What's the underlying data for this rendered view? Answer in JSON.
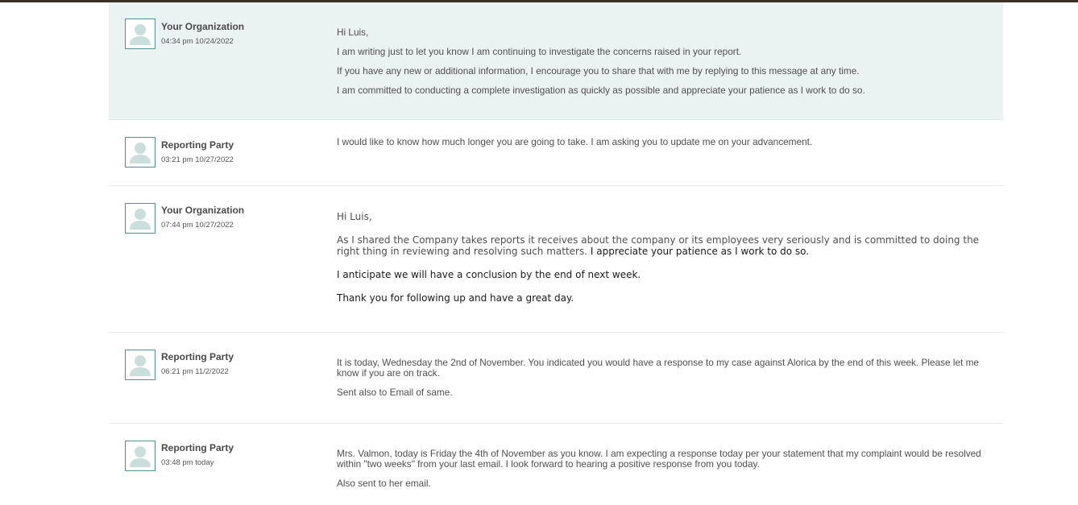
{
  "messages": [
    {
      "sender": "Your Organization",
      "time": "04:34 pm 10/24/2022",
      "paragraphs": [
        "Hi Luis,",
        "I am writing just to let you know I am continuing to investigate the concerns raised in your report.",
        "If you have any new or additional information, I encourage you to share that with me by replying to this message at any time.",
        "I am committed to conducting a complete investigation as quickly as possible and appreciate your patience as I work to do so."
      ]
    },
    {
      "sender": "Reporting Party",
      "time": "03:21 pm 10/27/2022",
      "paragraphs": [
        "I would like to know how much longer you are going to take. I am asking you to update me on your advancement."
      ]
    },
    {
      "sender": "Your Organization",
      "time": "07:44 pm 10/27/2022",
      "greeting": "Hi Luis,",
      "para1_gray": "As I shared the Company takes reports it receives about the company or its employees very seriously and is committed to doing the right thing in reviewing and resolving such matters.",
      "para1_dark": " I appreciate your patience as I work to do so.",
      "para2": "I anticipate we will have a conclusion by the end of next week.",
      "para3": "Thank you for following up and have a great day."
    },
    {
      "sender": "Reporting Party",
      "time": "06:21 pm 11/2/2022",
      "paragraphs": [
        "It is today, Wednesday the 2nd of November. You indicated you would have a response to my case against Alorica by the end of this week. Please let me know if you are on track.",
        "Sent also to Email of same."
      ]
    },
    {
      "sender": "Reporting Party",
      "time": "03:48 pm today",
      "paragraphs": [
        "Mrs. Valmon, today is Friday the 4th of November as you know. I am expecting a response today per your statement that my complaint would be resolved within \"two weeks\" from your last email. I look forward to hearing a positive response from you today.",
        "Also sent to her email."
      ]
    }
  ],
  "colors": {
    "highlight_bg": "#eaf3f1",
    "avatar_border": "#4f8f95",
    "avatar_fill": "#c9dedd"
  }
}
